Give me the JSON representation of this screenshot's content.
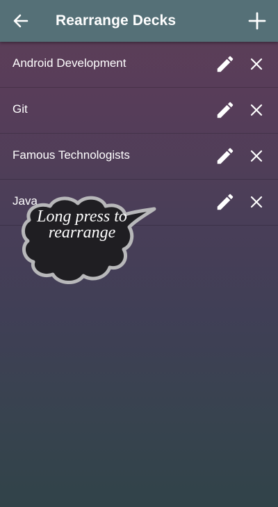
{
  "appbar": {
    "title": "Rearrange Decks",
    "back_icon": "arrow-left-icon",
    "add_icon": "plus-icon"
  },
  "decks": [
    {
      "name": "Android Development"
    },
    {
      "name": "Git"
    },
    {
      "name": "Famous Technologists"
    },
    {
      "name": "Java"
    }
  ],
  "row_icons": {
    "edit": "pencil-icon",
    "remove": "close-icon"
  },
  "hint": {
    "text": "Long press to rearrange"
  },
  "colors": {
    "appbar": "#557077",
    "gradient_top": "#5e3e58",
    "gradient_bottom": "#314349",
    "hint_bubble": "#1f1e22"
  }
}
